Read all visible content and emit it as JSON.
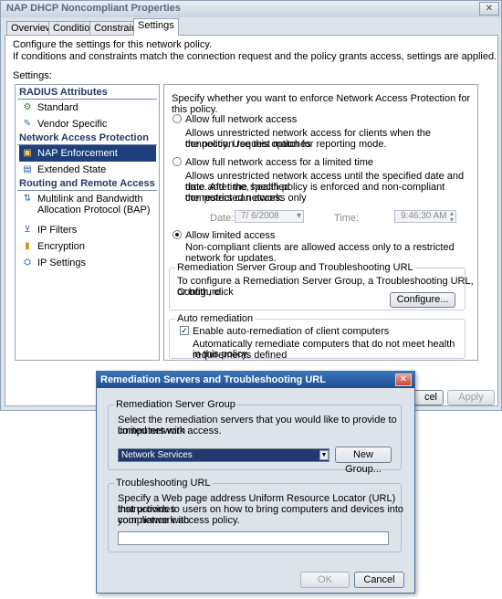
{
  "main_window": {
    "title": "NAP DHCP Noncompliant Properties",
    "tabs": [
      {
        "label": "Overview"
      },
      {
        "label": "Conditions"
      },
      {
        "label": "Constraints"
      },
      {
        "label": "Settings",
        "active": true
      }
    ],
    "description_line1": "Configure the settings for this network policy.",
    "description_line2": "If conditions and constraints match the connection request and the policy grants access, settings are applied.",
    "settings_label": "Settings:",
    "categories": [
      {
        "title": "RADIUS Attributes",
        "items": [
          {
            "label": "Standard",
            "icon": "standard-icon"
          },
          {
            "label": "Vendor Specific",
            "icon": "vendor-specific-icon"
          }
        ]
      },
      {
        "title": "Network Access Protection",
        "items": [
          {
            "label": "NAP Enforcement",
            "icon": "nap-enforcement-icon",
            "selected": true
          },
          {
            "label": "Extended State",
            "icon": "extended-state-icon"
          }
        ]
      },
      {
        "title": "Routing and Remote Access",
        "items": [
          {
            "label_line1": "Multilink and Bandwidth",
            "label_line2": "Allocation Protocol (BAP)",
            "icon": "multilink-icon"
          },
          {
            "label": "IP Filters",
            "icon": "ip-filters-icon"
          },
          {
            "label": "Encryption",
            "icon": "encryption-icon"
          },
          {
            "label": "IP Settings",
            "icon": "ip-settings-icon"
          }
        ]
      }
    ],
    "panel": {
      "intro": "Specify whether you want to enforce Network Access Protection for this policy.",
      "opt_full": "Allow full network access",
      "opt_full_desc1": "Allows unrestricted network access for clients when the connection request matches",
      "opt_full_desc2": "the policy.  Use this option for reporting mode.",
      "opt_limited_time": "Allow full network access for a limited time",
      "opt_limited_time_desc1": "Allows unrestricted network access until the specified date and time. After the specified",
      "opt_limited_time_desc2": "date and time, health policy is enforced and non-compliant computers can access only",
      "opt_limited_time_desc3": "the restricted network.",
      "date_label": "Date:",
      "date_value": "7/  6/2008",
      "time_label": "Time:",
      "time_value": "9:46:30 AM",
      "opt_limited": "Allow limited access",
      "opt_limited_desc": "Non-compliant clients are allowed access only to a restricted network for updates.",
      "remediation_group_title": "Remediation Server Group and Troubleshooting URL",
      "remediation_desc1": "To configure a Remediation Server Group, a Troubleshooting URL, or both, click",
      "remediation_desc2": "Configure.",
      "configure_button": "Configure...",
      "auto_group_title": "Auto remediation",
      "auto_check_label": "Enable auto-remediation of client computers",
      "auto_desc1": "Automatically remediate computers that do not meet health requirements defined",
      "auto_desc2": "in this policy."
    },
    "cancel_button_partial": "cel",
    "apply_button": "Apply"
  },
  "dialog": {
    "title": "Remediation Servers and Troubleshooting URL",
    "server_group_title": "Remediation Server Group",
    "server_group_desc1": "Select the remediation servers that you would like to provide to computers with",
    "server_group_desc2": "limited network access.",
    "server_group_value": "Network Services",
    "new_group_button": "New Group...",
    "url_group_title": "Troubleshooting URL",
    "url_desc1": "Specify a Web page address Uniform Resource Locator (URL) that provides",
    "url_desc2": "instructions to users on how to bring computers and devices into compliance with",
    "url_desc3": "your network access policy.",
    "url_value": "",
    "ok_button": "OK",
    "cancel_button": "Cancel"
  }
}
